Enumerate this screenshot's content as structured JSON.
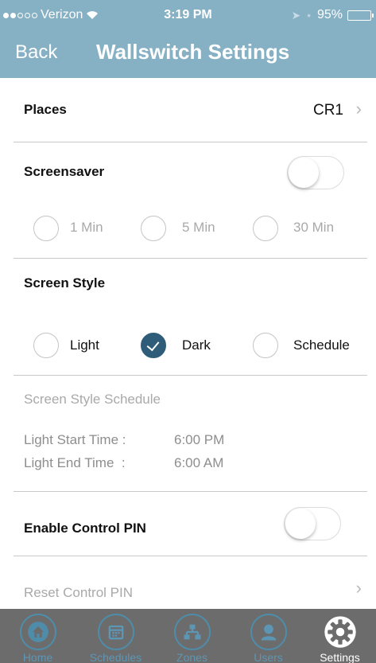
{
  "status_bar": {
    "carrier": "Verizon",
    "time": "3:19 PM",
    "battery": "95%"
  },
  "nav": {
    "back": "Back",
    "title": "Wallswitch Settings"
  },
  "places": {
    "label": "Places",
    "value": "CR1"
  },
  "screensaver": {
    "label": "Screensaver",
    "enabled": false,
    "options": [
      "1 Min",
      "5 Min",
      "30 Min"
    ]
  },
  "screen_style": {
    "label": "Screen Style",
    "options": [
      "Light",
      "Dark",
      "Schedule"
    ],
    "selected": "Dark"
  },
  "schedule": {
    "heading": "Screen Style Schedule",
    "start_label": "Light Start Time :",
    "start_value": "6:00 PM",
    "end_label": "Light End Time  :",
    "end_value": "6:00 AM"
  },
  "control_pin": {
    "enable_label": "Enable Control PIN",
    "enabled": false,
    "reset_label": "Reset Control PIN"
  },
  "tabs": [
    {
      "label": "Home",
      "icon": "home-icon"
    },
    {
      "label": "Schedules",
      "icon": "calendar-icon"
    },
    {
      "label": "Zones",
      "icon": "zones-icon"
    },
    {
      "label": "Users",
      "icon": "user-icon"
    },
    {
      "label": "Settings",
      "icon": "gear-icon",
      "active": true
    }
  ],
  "colors": {
    "header": "#86b0c4",
    "accent": "#2f5d79",
    "tabbar": "#6c6c6c",
    "tab_icon": "#5d96b4"
  }
}
